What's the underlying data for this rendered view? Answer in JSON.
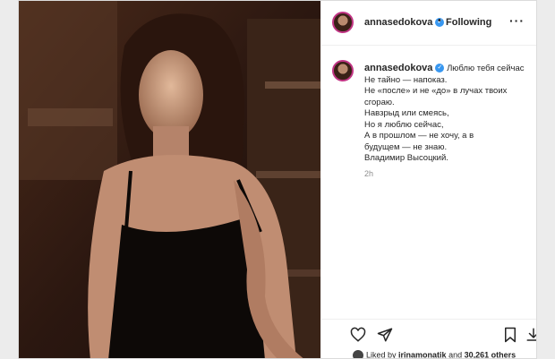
{
  "post": {
    "username": "annasedokova",
    "following_label": "Following",
    "separator": "•",
    "more_label": "···",
    "caption_lines": [
      "Люблю тебя сейчас",
      "Не тайно — напоказ.",
      "Не «после» и не «до» в лучах твоих",
      "сгораю.",
      "Навзрыд или смеясь,",
      "Но я люблю сейчас,",
      "А в прошлом — не хочу, а в",
      "будущем — не знаю.",
      "Владимир Высоцкий."
    ],
    "time_ago": "2h",
    "liked_by_prefix": "Liked by",
    "liked_by_user": "irinamonatik",
    "and_label": "and",
    "others_count": "30,261 others"
  },
  "icons": {
    "verified": "verified-badge-icon",
    "like": "heart-icon",
    "share": "paper-plane-icon",
    "save": "bookmark-icon",
    "download": "download-icon"
  },
  "colors": {
    "verified": "#3897f0",
    "text": "#262626",
    "muted": "#8e8e8e",
    "story_ring": "#c13584"
  }
}
